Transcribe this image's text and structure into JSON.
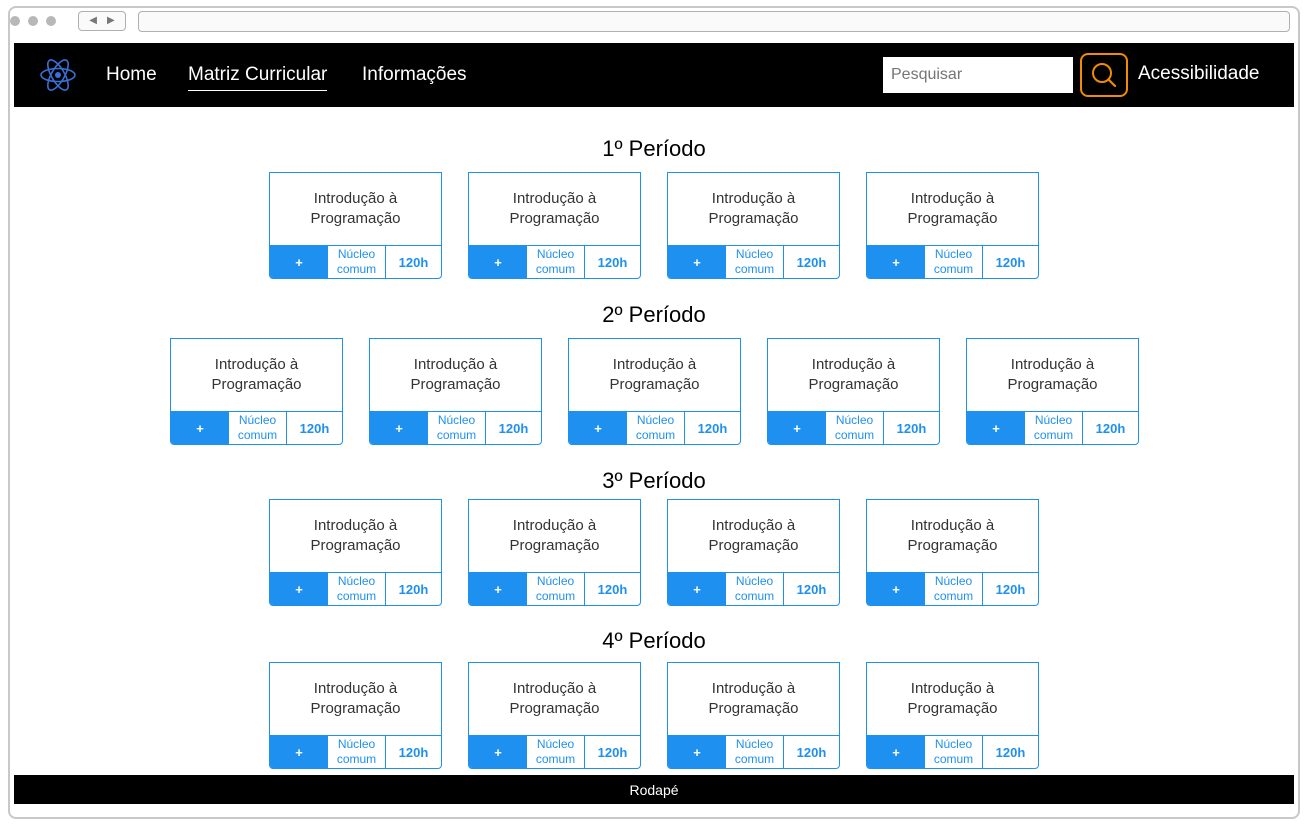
{
  "header": {
    "nav": [
      "Home",
      "Matriz Curricular",
      "Informações"
    ],
    "active_nav": "Matriz Curricular",
    "search_placeholder": "Pesquisar",
    "accessibility_label": "Acessibilidade",
    "accent_color": "#f08c00"
  },
  "periods": [
    {
      "title": "1º Período",
      "courses": [
        {
          "name_line1": "Introdução à",
          "name_line2": "Programação",
          "plus": "+",
          "core_line1": "Núcleo",
          "core_line2": "comum",
          "hours": "120h"
        },
        {
          "name_line1": "Introdução à",
          "name_line2": "Programação",
          "plus": "+",
          "core_line1": "Núcleo",
          "core_line2": "comum",
          "hours": "120h"
        },
        {
          "name_line1": "Introdução à",
          "name_line2": "Programação",
          "plus": "+",
          "core_line1": "Núcleo",
          "core_line2": "comum",
          "hours": "120h"
        },
        {
          "name_line1": "Introdução à",
          "name_line2": "Programação",
          "plus": "+",
          "core_line1": "Núcleo",
          "core_line2": "comum",
          "hours": "120h"
        }
      ]
    },
    {
      "title": "2º Período",
      "courses": [
        {
          "name_line1": "Introdução à",
          "name_line2": "Programação",
          "plus": "+",
          "core_line1": "Núcleo",
          "core_line2": "comum",
          "hours": "120h"
        },
        {
          "name_line1": "Introdução à",
          "name_line2": "Programação",
          "plus": "+",
          "core_line1": "Núcleo",
          "core_line2": "comum",
          "hours": "120h"
        },
        {
          "name_line1": "Introdução à",
          "name_line2": "Programação",
          "plus": "+",
          "core_line1": "Núcleo",
          "core_line2": "comum",
          "hours": "120h"
        },
        {
          "name_line1": "Introdução à",
          "name_line2": "Programação",
          "plus": "+",
          "core_line1": "Núcleo",
          "core_line2": "comum",
          "hours": "120h"
        },
        {
          "name_line1": "Introdução à",
          "name_line2": "Programação",
          "plus": "+",
          "core_line1": "Núcleo",
          "core_line2": "comum",
          "hours": "120h"
        }
      ]
    },
    {
      "title": "3º Período",
      "courses": [
        {
          "name_line1": "Introdução à",
          "name_line2": "Programação",
          "plus": "+",
          "core_line1": "Núcleo",
          "core_line2": "comum",
          "hours": "120h"
        },
        {
          "name_line1": "Introdução à",
          "name_line2": "Programação",
          "plus": "+",
          "core_line1": "Núcleo",
          "core_line2": "comum",
          "hours": "120h"
        },
        {
          "name_line1": "Introdução à",
          "name_line2": "Programação",
          "plus": "+",
          "core_line1": "Núcleo",
          "core_line2": "comum",
          "hours": "120h"
        },
        {
          "name_line1": "Introdução à",
          "name_line2": "Programação",
          "plus": "+",
          "core_line1": "Núcleo",
          "core_line2": "comum",
          "hours": "120h"
        }
      ]
    },
    {
      "title": "4º Período",
      "courses": [
        {
          "name_line1": "Introdução à",
          "name_line2": "Programação",
          "plus": "+",
          "core_line1": "Núcleo",
          "core_line2": "comum",
          "hours": "120h"
        },
        {
          "name_line1": "Introdução à",
          "name_line2": "Programação",
          "plus": "+",
          "core_line1": "Núcleo",
          "core_line2": "comum",
          "hours": "120h"
        },
        {
          "name_line1": "Introdução à",
          "name_line2": "Programação",
          "plus": "+",
          "core_line1": "Núcleo",
          "core_line2": "comum",
          "hours": "120h"
        },
        {
          "name_line1": "Introdução à",
          "name_line2": "Programação",
          "plus": "+",
          "core_line1": "Núcleo",
          "core_line2": "comum",
          "hours": "120h"
        }
      ]
    }
  ],
  "footer": {
    "label": "Rodapé"
  },
  "icons": [
    "atom-logo-icon",
    "search-icon",
    "back-arrow-icon",
    "forward-arrow-icon"
  ],
  "colors": {
    "header_bg": "#000000",
    "card_accent": "#1e90f0",
    "search_border": "#f08c00"
  }
}
